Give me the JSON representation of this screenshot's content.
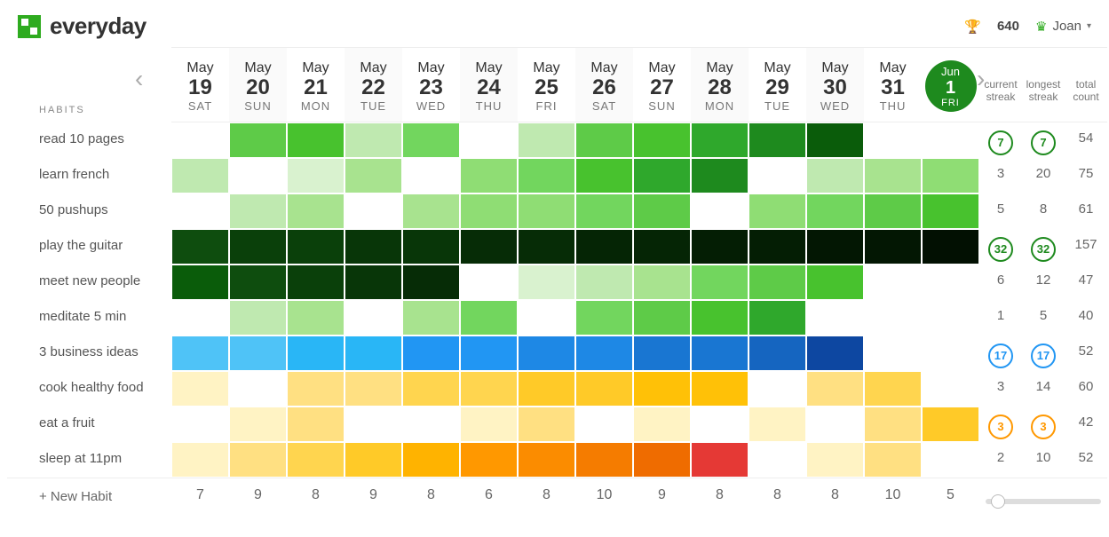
{
  "brand": "everyday",
  "header": {
    "points": "640",
    "user": "Joan"
  },
  "labels": {
    "habits": "HABITS",
    "new_habit": "+ New Habit",
    "current_streak": "current streak",
    "longest_streak": "longest streak",
    "total_count": "total count"
  },
  "dates": [
    {
      "month": "May",
      "day": "19",
      "dow": "SAT"
    },
    {
      "month": "May",
      "day": "20",
      "dow": "SUN"
    },
    {
      "month": "May",
      "day": "21",
      "dow": "MON"
    },
    {
      "month": "May",
      "day": "22",
      "dow": "TUE"
    },
    {
      "month": "May",
      "day": "23",
      "dow": "WED"
    },
    {
      "month": "May",
      "day": "24",
      "dow": "THU"
    },
    {
      "month": "May",
      "day": "25",
      "dow": "FRI"
    },
    {
      "month": "May",
      "day": "26",
      "dow": "SAT"
    },
    {
      "month": "May",
      "day": "27",
      "dow": "SUN"
    },
    {
      "month": "May",
      "day": "28",
      "dow": "MON"
    },
    {
      "month": "May",
      "day": "29",
      "dow": "TUE"
    },
    {
      "month": "May",
      "day": "30",
      "dow": "WED"
    },
    {
      "month": "May",
      "day": "31",
      "dow": "THU"
    },
    {
      "month": "Jun",
      "day": "1",
      "dow": "FRI"
    }
  ],
  "today_index": 13,
  "habits": [
    {
      "name": "read 10 pages",
      "current": "7",
      "longest": "7",
      "total": "54",
      "ring": "#1e8a1e",
      "cells": [
        "",
        "#5ecb48",
        "#48c22e",
        "#bfe9b0",
        "#72d65e",
        "",
        "#bfe9b0",
        "#5ecb48",
        "#48c22e",
        "#2fa82c",
        "#1e8a1e",
        "#0a5c0a",
        ""
      ]
    },
    {
      "name": "learn french",
      "current": "3",
      "longest": "20",
      "total": "75",
      "ring": "",
      "cells": [
        "#bfe9b0",
        "",
        "#d9f2cf",
        "#a8e38f",
        "",
        "#8fdd74",
        "#72d65e",
        "#48c22e",
        "#2fa82c",
        "#1e8a1e",
        "",
        "#bfe9b0",
        "#a8e38f",
        "#8fdd74"
      ]
    },
    {
      "name": "50 pushups",
      "current": "5",
      "longest": "8",
      "total": "61",
      "ring": "",
      "cells": [
        "",
        "#bfe9b0",
        "#a8e38f",
        "",
        "#a8e38f",
        "#8fdd74",
        "#8fdd74",
        "#72d65e",
        "#5ecb48",
        "",
        "#8fdd74",
        "#72d65e",
        "#5ecb48",
        "#48c22e"
      ]
    },
    {
      "name": "play the guitar",
      "current": "32",
      "longest": "32",
      "total": "157",
      "ring": "#1e8a1e",
      "cells": [
        "#0e4d0e",
        "#0a400a",
        "#0a400a",
        "#083608",
        "#083608",
        "#062c06",
        "#062c06",
        "#052505",
        "#052505",
        "#041e04",
        "#041e04",
        "#031703",
        "#031703",
        "#021002"
      ]
    },
    {
      "name": "meet new people",
      "current": "6",
      "longest": "12",
      "total": "47",
      "ring": "",
      "cells": [
        "#0a5c0a",
        "#0e4d0e",
        "#0a400a",
        "#083608",
        "#062c06",
        "",
        "#d9f2cf",
        "#bfe9b0",
        "#a8e38f",
        "#72d65e",
        "#5ecb48",
        "#48c22e",
        "",
        ""
      ]
    },
    {
      "name": "meditate 5 min",
      "current": "1",
      "longest": "5",
      "total": "40",
      "ring": "",
      "cells": [
        "",
        "#bfe9b0",
        "#a8e38f",
        "",
        "#a8e38f",
        "#72d65e",
        "",
        "#72d65e",
        "#5ecb48",
        "#48c22e",
        "#2fa82c",
        "",
        "",
        ""
      ]
    },
    {
      "name": "3 business ideas",
      "current": "17",
      "longest": "17",
      "total": "52",
      "ring": "#2196f3",
      "cells": [
        "#4fc3f7",
        "#4fc3f7",
        "#29b6f6",
        "#29b6f6",
        "#2196f3",
        "#2196f3",
        "#1e88e5",
        "#1e88e5",
        "#1976d2",
        "#1976d2",
        "#1565c0",
        "#0d47a1",
        "",
        ""
      ]
    },
    {
      "name": "cook healthy food",
      "current": "3",
      "longest": "14",
      "total": "60",
      "ring": "",
      "cells": [
        "#fff3c4",
        "",
        "#ffe082",
        "#ffe082",
        "#ffd54f",
        "#ffd54f",
        "#ffca28",
        "#ffca28",
        "#ffc107",
        "#ffc107",
        "",
        "#ffe082",
        "#ffd54f",
        ""
      ]
    },
    {
      "name": "eat a fruit",
      "current": "3",
      "longest": "3",
      "total": "42",
      "ring": "#ff9800",
      "cells": [
        "",
        "#fff3c4",
        "#ffe082",
        "",
        "",
        "#fff3c4",
        "#ffe082",
        "",
        "#fff3c4",
        "",
        "#fff3c4",
        "",
        "#ffe082",
        "#ffca28"
      ]
    },
    {
      "name": "sleep at 11pm",
      "current": "2",
      "longest": "10",
      "total": "52",
      "ring": "",
      "cells": [
        "#fff3c4",
        "#ffe082",
        "#ffd54f",
        "#ffca28",
        "#ffb300",
        "#ff9800",
        "#fb8c00",
        "#f57c00",
        "#ef6c00",
        "#e53935",
        "",
        "#fff3c4",
        "#ffe082",
        ""
      ]
    }
  ],
  "day_totals": [
    "7",
    "9",
    "8",
    "9",
    "8",
    "6",
    "8",
    "10",
    "9",
    "8",
    "8",
    "8",
    "10",
    "5"
  ]
}
